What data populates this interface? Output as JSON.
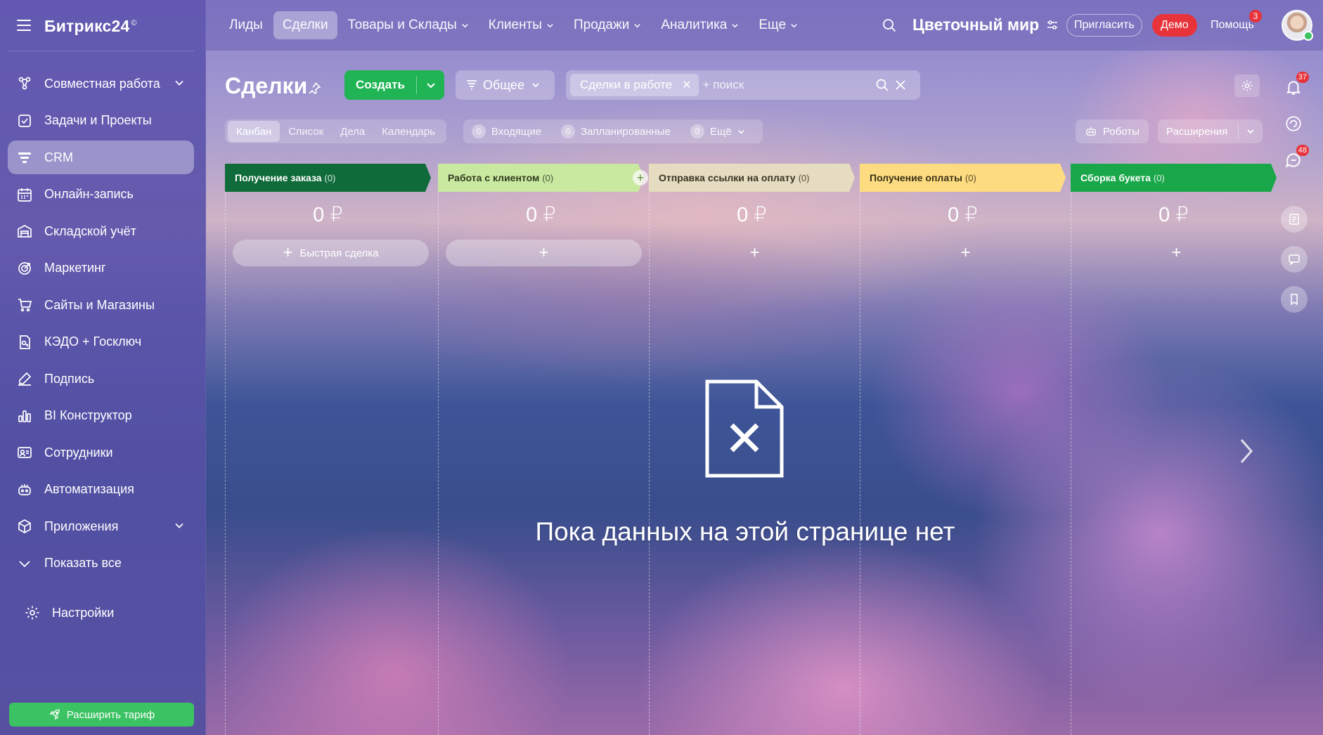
{
  "app": {
    "logo": "Битрикс24",
    "logo_mark": "©"
  },
  "sidebar": {
    "items": [
      {
        "label": "Совместная работа",
        "icon": "collab-icon",
        "has_chevron": true
      },
      {
        "label": "Задачи и Проекты",
        "icon": "tasks-icon"
      },
      {
        "label": "CRM",
        "icon": "crm-icon",
        "active": true
      },
      {
        "label": "Онлайн-запись",
        "icon": "booking-icon"
      },
      {
        "label": "Складской учёт",
        "icon": "warehouse-icon"
      },
      {
        "label": "Маркетинг",
        "icon": "marketing-icon"
      },
      {
        "label": "Сайты и Магазины",
        "icon": "cart-icon"
      },
      {
        "label": "КЭДО + Госключ",
        "icon": "document-key-icon"
      },
      {
        "label": "Подпись",
        "icon": "signature-icon"
      },
      {
        "label": "BI Конструктор",
        "icon": "bi-chart-icon"
      },
      {
        "label": "Сотрудники",
        "icon": "employees-icon"
      },
      {
        "label": "Автоматизация",
        "icon": "automation-icon"
      },
      {
        "label": "Приложения",
        "icon": "apps-icon",
        "has_chevron": true
      },
      {
        "label": "Показать все",
        "icon": "chevron-down-icon"
      }
    ],
    "settings_label": "Настройки",
    "expand_plan_label": "Расширить тариф"
  },
  "topnav": {
    "items": [
      {
        "label": "Лиды"
      },
      {
        "label": "Сделки",
        "active": true
      },
      {
        "label": "Товары и Склады",
        "dropdown": true
      },
      {
        "label": "Клиенты",
        "dropdown": true
      },
      {
        "label": "Продажи",
        "dropdown": true
      },
      {
        "label": "Аналитика",
        "dropdown": true
      },
      {
        "label": "Еще",
        "dropdown": true
      }
    ],
    "company": "Цветочный мир",
    "invite_label": "Пригласить",
    "demo_label": "Демо",
    "help_label": "Помощь",
    "help_badge": "3"
  },
  "header": {
    "title": "Сделки",
    "create_label": "Создать",
    "filter_label": "Общее",
    "search_chip": "Сделки в работе",
    "search_placeholder": "+ поиск"
  },
  "view_tabs": [
    {
      "label": "Канбан",
      "active": true
    },
    {
      "label": "Список"
    },
    {
      "label": "Дела"
    },
    {
      "label": "Календарь"
    }
  ],
  "counters": [
    {
      "count": "0",
      "label": "Входящие"
    },
    {
      "count": "0",
      "label": "Запланированные"
    },
    {
      "count": "0",
      "label": "Ещё",
      "dropdown": true
    }
  ],
  "robots_label": "Роботы",
  "extensions_label": "Расширения",
  "rail": {
    "notifications_badge": "37",
    "chat_badge": "48"
  },
  "stages": [
    {
      "name": "Получение заказа",
      "count": "(0)",
      "amount": "0 ₽",
      "color": "#0f6b3a",
      "text_color": "#ffffff",
      "add_label": "Быстрая сделка"
    },
    {
      "name": "Работа с клиентом",
      "count": "(0)",
      "amount": "0 ₽",
      "color": "#c9e8a0",
      "text_color": "#2f3b1e",
      "add_label": ""
    },
    {
      "name": "Отправка ссылки на оплату",
      "count": "(0)",
      "amount": "0 ₽",
      "color": "#e6dcc1",
      "text_color": "#3a3322",
      "add_label": ""
    },
    {
      "name": "Получение оплаты",
      "count": "(0)",
      "amount": "0 ₽",
      "color": "#fddc81",
      "text_color": "#3b3016",
      "add_label": ""
    },
    {
      "name": "Сборка букета",
      "count": "(0)",
      "amount": "0 ₽",
      "color": "#1aa74a",
      "text_color": "#ffffff",
      "add_label": ""
    }
  ],
  "empty_state": "Пока данных на этой странице нет"
}
